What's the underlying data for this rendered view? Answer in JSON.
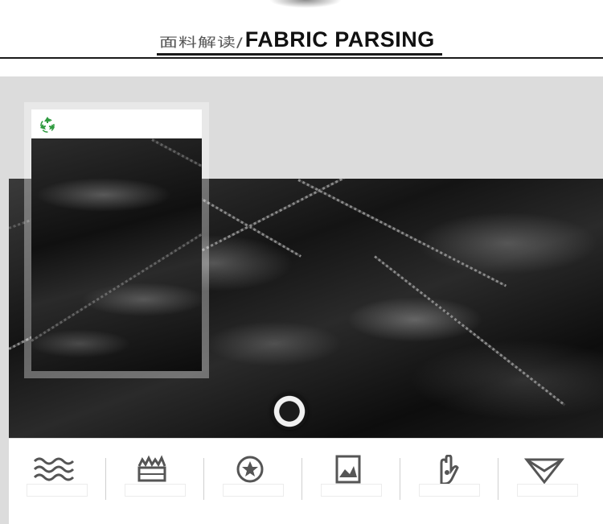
{
  "header": {
    "title_cn": "面料解读/",
    "title_en": "FABRIC PARSING"
  },
  "inset": {
    "badge_icon": "recycle-icon"
  },
  "features": [
    {
      "icon": "water-waves-icon",
      "caption": ""
    },
    {
      "icon": "warmth-box-icon",
      "caption": ""
    },
    {
      "icon": "down-fill-icon",
      "caption": ""
    },
    {
      "icon": "fabric-swatch-icon",
      "caption": ""
    },
    {
      "icon": "soft-touch-hand-icon",
      "caption": ""
    },
    {
      "icon": "collar-fold-icon",
      "caption": ""
    }
  ],
  "colors": {
    "accent_dark": "#111111",
    "panel_gray": "#dcdcdc",
    "icon_gray": "#555555",
    "recycle_green": "#2f9a3f"
  }
}
